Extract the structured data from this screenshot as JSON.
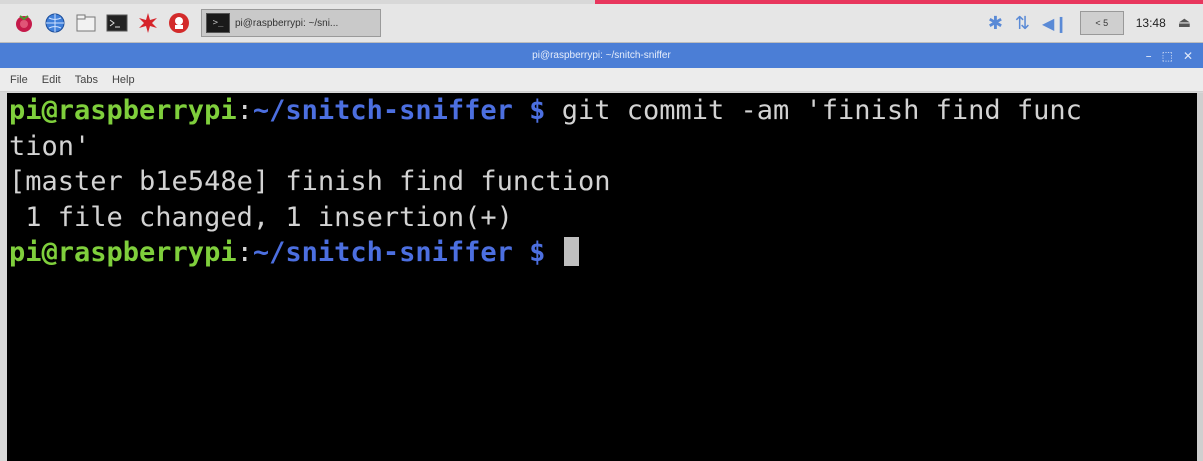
{
  "taskbar": {
    "launchers": [
      "raspberry-menu-icon",
      "web-browser-icon",
      "file-manager-icon",
      "terminal-icon",
      "math-kernel-icon",
      "wolfram-icon"
    ],
    "task_button_label": "pi@raspberrypi: ~/sni..."
  },
  "tray": {
    "cpu_label": "< 5",
    "clock": "13:48"
  },
  "window": {
    "title": "pi@raspberrypi: ~/snitch-sniffer"
  },
  "menu": {
    "file": "File",
    "edit": "Edit",
    "tabs": "Tabs",
    "help": "Help"
  },
  "terminal": {
    "prompt_user": "pi@raspberrypi",
    "prompt_sep": ":",
    "prompt_path": "~/snitch-sniffer $",
    "cmd1": " git commit -am 'finish find func",
    "cmd1_wrap": "tion'",
    "out1": "[master b1e548e] finish find function",
    "out2": " 1 file changed, 1 insertion(+)"
  },
  "colors": {
    "prompt_user": "#7fcf3c",
    "prompt_path": "#4c6fe0",
    "titlebar": "#4b7ed6",
    "accent_corner": "#e8365d"
  }
}
